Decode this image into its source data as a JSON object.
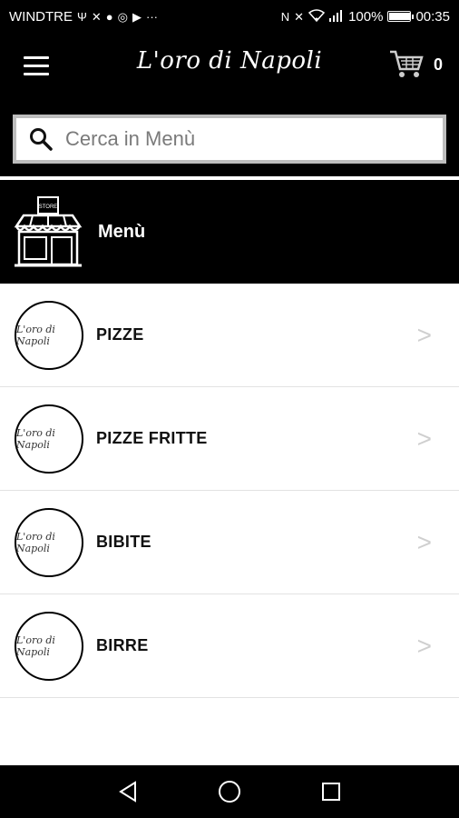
{
  "status_bar": {
    "carrier": "WINDTRE",
    "battery": "100%",
    "battery_level": 1.0,
    "time": "00:35"
  },
  "header": {
    "brand": "L'oro di Napoli",
    "cart_count": "0"
  },
  "search": {
    "placeholder": "Cerca in Menù"
  },
  "menu_section": {
    "title": "Menù",
    "store_sign": "STORE"
  },
  "categories": [
    {
      "label": "PIZZE",
      "logo_text": "L'oro di Napoli"
    },
    {
      "label": "PIZZE FRITTE",
      "logo_text": "L'oro di Napoli"
    },
    {
      "label": "BIBITE",
      "logo_text": "L'oro di Napoli"
    },
    {
      "label": "BIRRE",
      "logo_text": "L'oro di Napoli"
    }
  ],
  "chevron": ">",
  "colors": {
    "bar_bg": "#000000",
    "search_border": "#bdbdbd",
    "chevron": "#cfcfcf",
    "divider": "#e2e2e2"
  }
}
